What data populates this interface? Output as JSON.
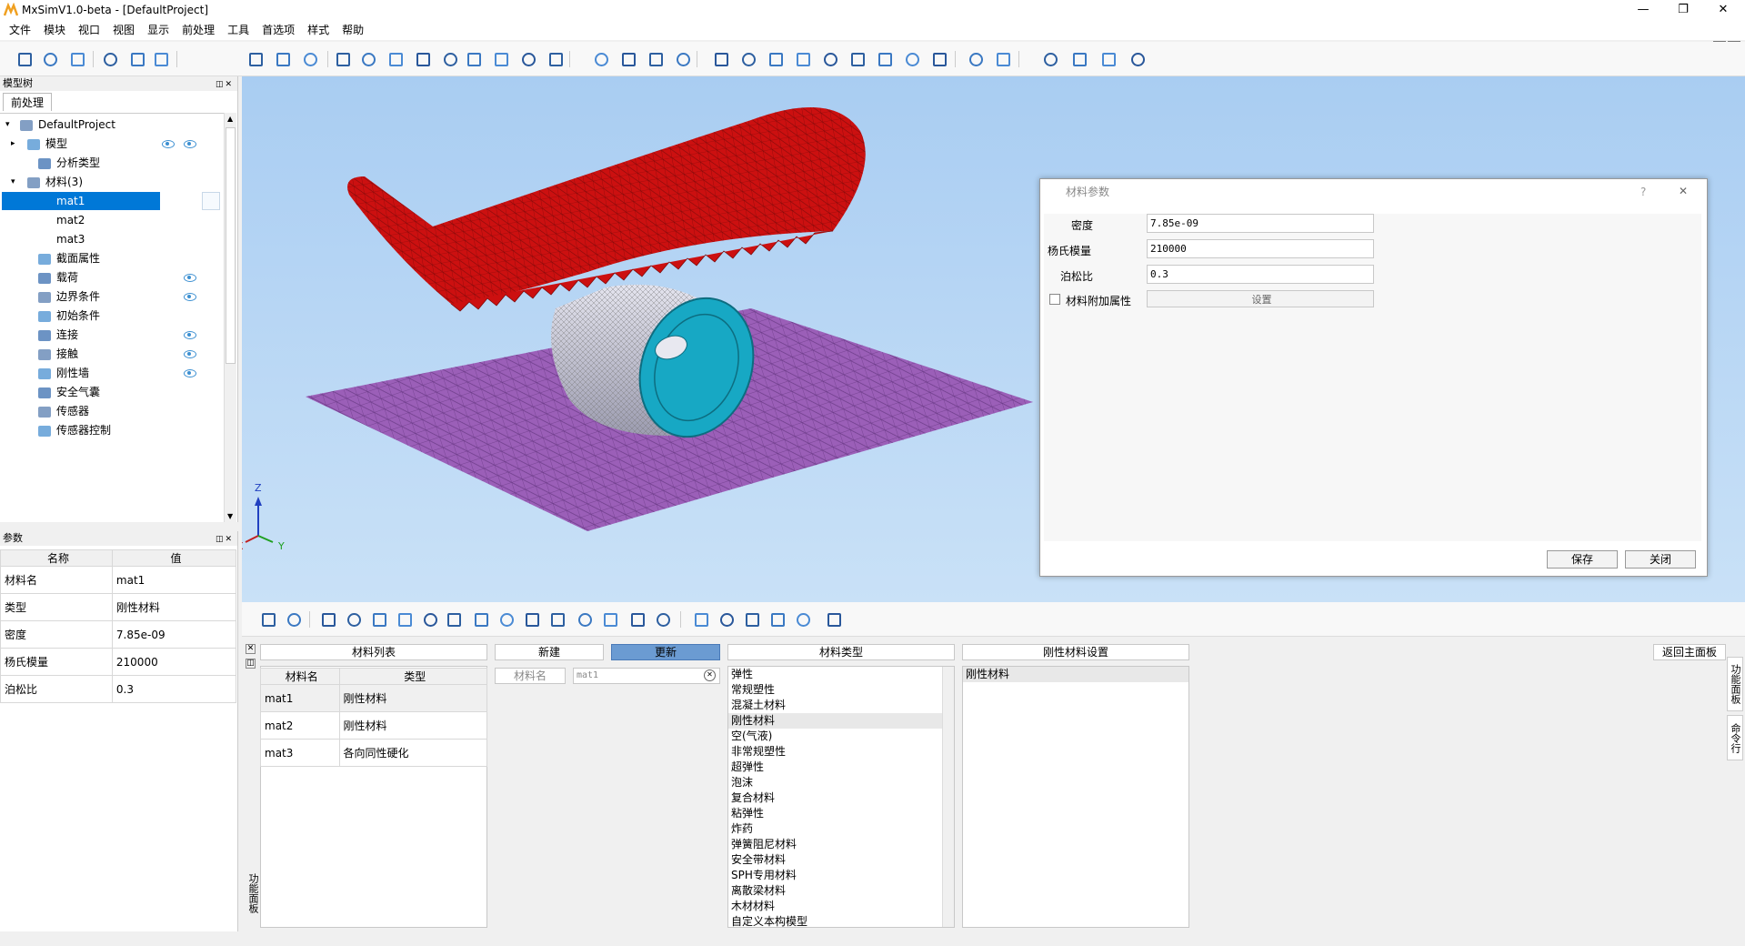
{
  "window": {
    "title": "MxSimV1.0-beta - [DefaultProject]",
    "min": "—",
    "max": "❐",
    "close": "✕"
  },
  "menu": [
    "文件",
    "模块",
    "视口",
    "视图",
    "显示",
    "前处理",
    "工具",
    "首选项",
    "样式",
    "帮助"
  ],
  "tree_panel": {
    "title": "模型树",
    "tab": "前处理",
    "items": [
      {
        "label": "DefaultProject"
      },
      {
        "label": "模型"
      },
      {
        "label": "分析类型"
      },
      {
        "label": "材料(3)"
      },
      {
        "label": "mat1"
      },
      {
        "label": "mat2"
      },
      {
        "label": "mat3"
      },
      {
        "label": "截面属性"
      },
      {
        "label": "载荷"
      },
      {
        "label": "边界条件"
      },
      {
        "label": "初始条件"
      },
      {
        "label": "连接"
      },
      {
        "label": "接触"
      },
      {
        "label": "刚性墙"
      },
      {
        "label": "安全气囊"
      },
      {
        "label": "传感器"
      },
      {
        "label": "传感器控制"
      }
    ]
  },
  "param_panel": {
    "title": "参数",
    "headers": [
      "名称",
      "值"
    ],
    "rows": [
      [
        "材料名",
        "mat1"
      ],
      [
        "类型",
        "刚性材料"
      ],
      [
        "密度",
        "7.85e-09"
      ],
      [
        "杨氏模量",
        "210000"
      ],
      [
        "泊松比",
        "0.3"
      ]
    ]
  },
  "axis": {
    "z": "Z",
    "x": "X",
    "y": "Y"
  },
  "dialog": {
    "title": "材料参数",
    "help": "?",
    "close": "✕",
    "fields": [
      {
        "label": "密度",
        "value": "7.85e-09"
      },
      {
        "label": "杨氏模量",
        "value": "210000"
      },
      {
        "label": "泊松比",
        "value": "0.3"
      }
    ],
    "checkbox_label": "材料附加属性",
    "settings_button": "设置",
    "save_button": "保存",
    "close_button": "关闭"
  },
  "bottom": {
    "material_list_header": "材料列表",
    "new_button": "新建",
    "update_button": "更新",
    "material_type_header": "材料类型",
    "rigid_settings_header": "刚性材料设置",
    "return_button": "返回主面板",
    "name_label": "材料名",
    "name_value": "mat1",
    "table_headers": [
      "材料名",
      "类型"
    ],
    "table_rows": [
      [
        "mat1",
        "刚性材料"
      ],
      [
        "mat2",
        "刚性材料"
      ],
      [
        "mat3",
        "各向同性硬化"
      ]
    ],
    "types": [
      "弹性",
      "常规塑性",
      "混凝土材料",
      "刚性材料",
      "空(气液)",
      "非常规塑性",
      "超弹性",
      "泡沫",
      "复合材料",
      "粘弹性",
      "炸药",
      "弹簧阻尼材料",
      "安全带材料",
      "SPH专用材料",
      "离散梁材料",
      "木材材料",
      "自定义本构模型"
    ],
    "rigid_value": "刚性材料",
    "side_tab_left": "功能面板",
    "side_tab_right1": "功能面板",
    "side_tab_right2": "命令行"
  },
  "colors": {
    "accent": "#0078d7",
    "update_btn": "#6b9bd2",
    "viewport_top": "#a9cdf2",
    "mesh_red": "#cc1010",
    "mesh_purple": "#9b5fb8",
    "cylinder": "#c8c8d8",
    "cap": "#17a8c4"
  }
}
